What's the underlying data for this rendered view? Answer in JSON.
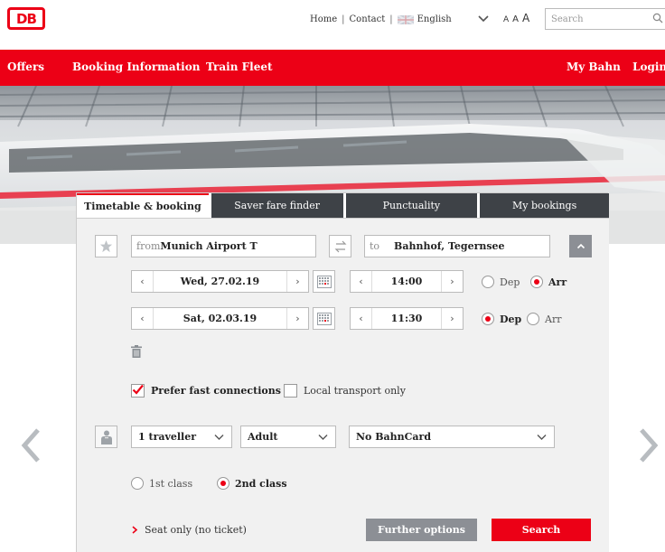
{
  "brand": {
    "logo": "DB",
    "color": "#ec0016"
  },
  "toplinks": {
    "home": "Home",
    "separator": "|",
    "contact": "Contact",
    "language": "English"
  },
  "fontsize": {
    "small": "A",
    "medium": "A",
    "large": "A"
  },
  "search": {
    "placeholder": "Search"
  },
  "nav": {
    "offers": "Offers",
    "booking_info": "Booking Information",
    "fleet": "Train Fleet",
    "my_bahn": "My Bahn",
    "login": "Login"
  },
  "tabs": [
    {
      "label": "Timetable & booking",
      "active": true
    },
    {
      "label": "Saver fare finder"
    },
    {
      "label": "Punctuality"
    },
    {
      "label": "My bookings"
    }
  ],
  "route": {
    "from_label": "from",
    "from_value": "Munich Airport T",
    "to_label": "to",
    "to_value": "Bahnhof, Tegernsee"
  },
  "outbound": {
    "date": "Wed, 27.02.19",
    "time": "14:00",
    "dep_label": "Dep",
    "arr_label": "Arr",
    "selected": "Arr"
  },
  "return": {
    "date": "Sat, 02.03.19",
    "time": "11:30",
    "dep_label": "Dep",
    "arr_label": "Arr",
    "selected": "Dep"
  },
  "options": {
    "prefer_fast": "Prefer fast connections",
    "prefer_fast_checked": true,
    "local_only": "Local transport only",
    "local_only_checked": false
  },
  "traveller": {
    "count": "1 traveller",
    "type": "Adult",
    "bahncard": "No BahnCard"
  },
  "class": {
    "first": "1st class",
    "second": "2nd class",
    "selected": "2nd class"
  },
  "footer": {
    "seat_only": "Seat only (no ticket)",
    "further_options": "Further options",
    "search": "Search"
  }
}
